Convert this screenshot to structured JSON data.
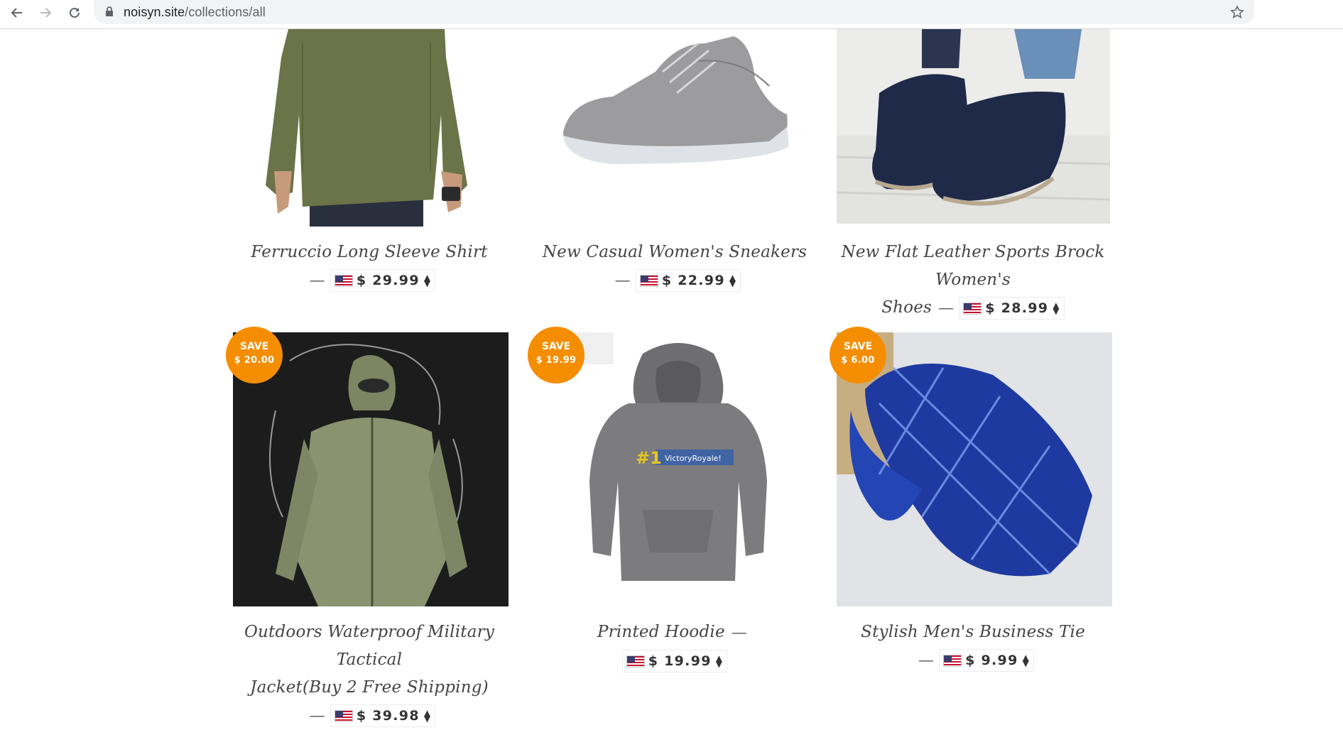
{
  "browser": {
    "url_domain": "noisyn.site",
    "url_path": "/collections/all"
  },
  "products": [
    {
      "title": "Ferruccio Long Sleeve Shirt",
      "price": "$ 29.99"
    },
    {
      "title": "New Casual Women's Sneakers",
      "price": "$ 22.99"
    },
    {
      "title_line1": "New Flat Leather Sports Brock Women's",
      "title_line2": "Shoes",
      "price": "$ 28.99"
    },
    {
      "title_line1": "Outdoors Waterproof Military Tactical",
      "title_line2": "Jacket(Buy 2 Free Shipping)",
      "price": "$ 39.98",
      "badge_label": "SAVE",
      "badge_amount": "$ 20.00"
    },
    {
      "title": "Printed Hoodie",
      "price": "$ 19.99",
      "badge_label": "SAVE",
      "badge_amount": "$ 19.99",
      "print_number": "#1",
      "print_text": "VictoryRoyale!"
    },
    {
      "title": "Stylish Men's Business Tie",
      "price": "$ 9.99",
      "badge_label": "SAVE",
      "badge_amount": "$ 6.00"
    }
  ],
  "separator": "—",
  "currency_sort_icon": "sort-arrows-icon",
  "colors": {
    "badge": "#f58d00",
    "text": "#444444"
  }
}
